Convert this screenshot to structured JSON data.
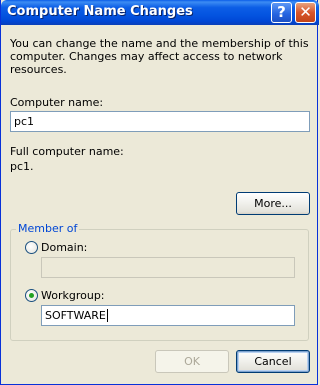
{
  "window": {
    "title": "Computer Name Changes",
    "help_glyph": "?",
    "close_glyph": "✕"
  },
  "intro": "You can change the name and the membership of this computer. Changes may affect access to network resources.",
  "computer_name": {
    "label": "Computer name:",
    "value": "pc1"
  },
  "full_name": {
    "label": "Full computer name:",
    "value": "pc1."
  },
  "more_button": "More...",
  "member_of": {
    "label": "Member of",
    "domain": {
      "label": "Domain:",
      "selected": false,
      "value": ""
    },
    "workgroup": {
      "label": "Workgroup:",
      "selected": true,
      "value": "SOFTWARE"
    }
  },
  "buttons": {
    "ok": "OK",
    "cancel": "Cancel"
  },
  "colors": {
    "titlebar": "#0454e0",
    "dialog_bg": "#ece9d8",
    "group_label": "#0046d5",
    "radio_dot": "#21a121"
  }
}
